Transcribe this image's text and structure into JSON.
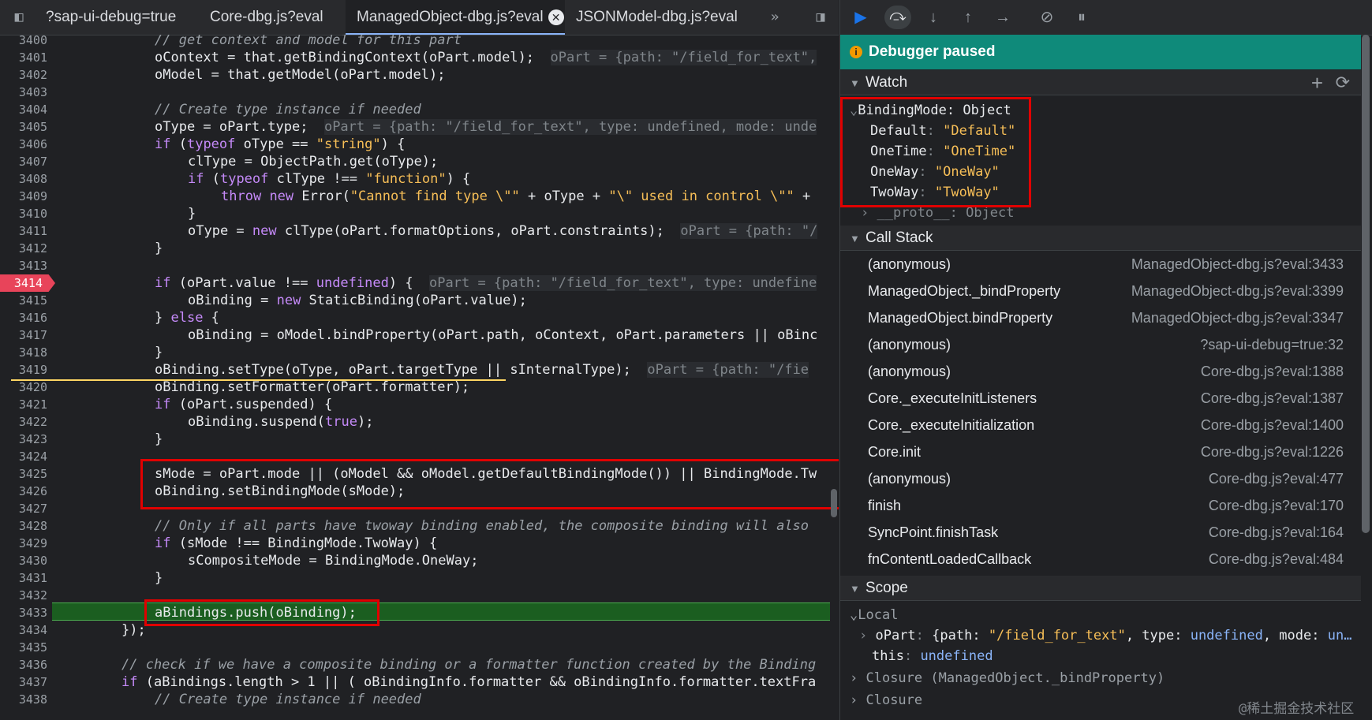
{
  "tabs": [
    {
      "label": "?sap-ui-debug=true"
    },
    {
      "label": "Core-dbg.js?eval"
    },
    {
      "label": "ManagedObject-dbg.js?eval",
      "active": true
    },
    {
      "label": "JSONModel-dbg.js?eval"
    }
  ],
  "tab_close_glyph": "✕",
  "tab_overflow_glyph": "»",
  "code_lines": [
    {
      "n": "3400"
    },
    {
      "n": "3401"
    },
    {
      "n": "3402"
    },
    {
      "n": "3403"
    },
    {
      "n": "3404"
    },
    {
      "n": "3405"
    },
    {
      "n": "3406"
    },
    {
      "n": "3407"
    },
    {
      "n": "3408"
    },
    {
      "n": "3409"
    },
    {
      "n": "3410"
    },
    {
      "n": "3411"
    },
    {
      "n": "3412"
    },
    {
      "n": "3413"
    },
    {
      "n": "3414",
      "breakpoint": true
    },
    {
      "n": "3415"
    },
    {
      "n": "3416"
    },
    {
      "n": "3417"
    },
    {
      "n": "3418"
    },
    {
      "n": "3419"
    },
    {
      "n": "3420"
    },
    {
      "n": "3421"
    },
    {
      "n": "3422"
    },
    {
      "n": "3423"
    },
    {
      "n": "3424"
    },
    {
      "n": "3425"
    },
    {
      "n": "3426"
    },
    {
      "n": "3427"
    },
    {
      "n": "3428"
    },
    {
      "n": "3429"
    },
    {
      "n": "3430"
    },
    {
      "n": "3431"
    },
    {
      "n": "3432"
    },
    {
      "n": "3433",
      "current": true
    },
    {
      "n": "3434"
    },
    {
      "n": "3435"
    },
    {
      "n": "3436"
    },
    {
      "n": "3437"
    },
    {
      "n": "3438"
    }
  ],
  "code_text": {
    "l3400": "// get context and model for this part",
    "l3401a": "oContext = that.getBindingContext(oPart.model);",
    "l3401i": "oPart = {path: \"/field_for_text\",",
    "l3402": "oModel = that.getModel(oPart.model);",
    "l3404": "// Create type instance if needed",
    "l3405a": "oType = oPart.type;",
    "l3405i": "oPart = {path: \"/field_for_text\", type: undefined, mode: unde",
    "l3406": "if (typeof oType == \"string\") {",
    "l3407": "clType = ObjectPath.get(oType);",
    "l3408": "if (typeof clType !== \"function\") {",
    "l3409": "throw new Error(\"Cannot find type \\\"\" + oType + \"\\\" used in control \\\"\" +",
    "l3410": "}",
    "l3411a": "oType = new clType(oPart.formatOptions, oPart.constraints);",
    "l3411i": "oPart = {path: \"/",
    "l3412": "}",
    "l3414a": "if (oPart.value !== undefined) {",
    "l3414i": "oPart = {path: \"/field_for_text\", type: undefine",
    "l3415": "oBinding = new StaticBinding(oPart.value);",
    "l3416": "} else {",
    "l3417": "oBinding = oModel.bindProperty(oPart.path, oContext, oPart.parameters || oBinc",
    "l3418": "}",
    "l3419a": "oBinding.setType(oType, oPart.targetType || sInternalType);",
    "l3419i": "oPart = {path: \"/fie",
    "l3420": "oBinding.setFormatter(oPart.formatter);",
    "l3421": "if (oPart.suspended) {",
    "l3422": "oBinding.suspend(true);",
    "l3423": "}",
    "l3425": "sMode = oPart.mode || (oModel && oModel.getDefaultBindingMode()) || BindingMode.Tw",
    "l3426": "oBinding.setBindingMode(sMode);",
    "l3428": "// Only if all parts have twoway binding enabled, the composite binding will also",
    "l3429": "if (sMode !== BindingMode.TwoWay) {",
    "l3430": "sCompositeMode = BindingMode.OneWay;",
    "l3431": "}",
    "l3433": "aBindings.push(oBinding);",
    "l3434": "});",
    "l3436": "// check if we have a composite binding or a formatter function created by the Binding",
    "l3437": "if (aBindings.length > 1 || ( oBindingInfo.formatter && oBindingInfo.formatter.textFra",
    "l3438": "// Create type instance if needed"
  },
  "debugger": {
    "status": "Debugger paused",
    "status_icon": "i",
    "watch": {
      "title": "Watch",
      "add_glyph": "+",
      "refresh_glyph": "⟳",
      "expr": "BindingMode",
      "expr_type": "Object",
      "props": [
        {
          "k": "Default",
          "v": "\"Default\""
        },
        {
          "k": "OneTime",
          "v": "\"OneTime\""
        },
        {
          "k": "OneWay",
          "v": "\"OneWay\""
        },
        {
          "k": "TwoWay",
          "v": "\"TwoWay\""
        }
      ],
      "proto_k": "__proto__",
      "proto_v": "Object"
    },
    "call_stack": {
      "title": "Call Stack",
      "frames": [
        {
          "fn": "(anonymous)",
          "loc": "ManagedObject-dbg.js?eval:3433"
        },
        {
          "fn": "ManagedObject._bindProperty",
          "loc": "ManagedObject-dbg.js?eval:3399"
        },
        {
          "fn": "ManagedObject.bindProperty",
          "loc": "ManagedObject-dbg.js?eval:3347"
        },
        {
          "fn": "(anonymous)",
          "loc": "?sap-ui-debug=true:32"
        },
        {
          "fn": "(anonymous)",
          "loc": "Core-dbg.js?eval:1388"
        },
        {
          "fn": "Core._executeInitListeners",
          "loc": "Core-dbg.js?eval:1387"
        },
        {
          "fn": "Core._executeInitialization",
          "loc": "Core-dbg.js?eval:1400"
        },
        {
          "fn": "Core.init",
          "loc": "Core-dbg.js?eval:1226"
        },
        {
          "fn": "(anonymous)",
          "loc": "Core-dbg.js?eval:477"
        },
        {
          "fn": "finish",
          "loc": "Core-dbg.js?eval:170"
        },
        {
          "fn": "SyncPoint.finishTask",
          "loc": "Core-dbg.js?eval:164"
        },
        {
          "fn": "fnContentLoadedCallback",
          "loc": "Core-dbg.js?eval:484"
        }
      ]
    },
    "scope": {
      "title": "Scope",
      "local_label": "Local",
      "opart_k": "oPart",
      "opart_v1": "{path: ",
      "opart_path": "\"/field_for_text\"",
      "opart_v2": ", type: ",
      "opart_undef1": "undefined",
      "opart_v3": ", mode: ",
      "opart_more": "un…",
      "this_k": "this",
      "this_v": "undefined",
      "closure1": "Closure (ManagedObject._bindProperty)",
      "closure2": "Closure"
    }
  },
  "watermark": "@稀土掘金技术社区"
}
